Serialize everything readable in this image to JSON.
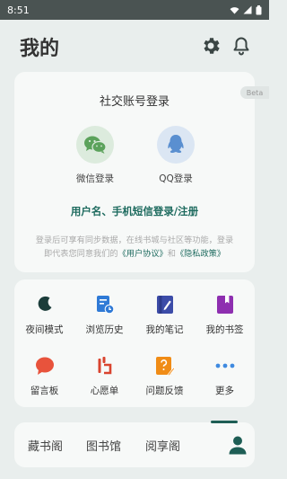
{
  "status": {
    "time": "8:51"
  },
  "header": {
    "title": "我的"
  },
  "login": {
    "title": "社交账号登录",
    "beta": "Beta",
    "wechat_label": "微信登录",
    "qq_label": "QQ登录",
    "phone_login": "用户名、手机短信登录/注册",
    "disclaimer_line1": "登录后可享有同步数据，在线书城与社区等功能，登录",
    "disclaimer_pre": "即代表您同意我们的",
    "user_agreement": "《用户协议》",
    "and": "和",
    "privacy_policy": "《隐私政策》"
  },
  "menu": [
    {
      "label": "夜间模式",
      "icon": "moon-icon"
    },
    {
      "label": "浏览历史",
      "icon": "history-icon"
    },
    {
      "label": "我的笔记",
      "icon": "notes-icon"
    },
    {
      "label": "我的书签",
      "icon": "bookmark-icon"
    },
    {
      "label": "留言板",
      "icon": "message-icon"
    },
    {
      "label": "心愿单",
      "icon": "wishlist-icon"
    },
    {
      "label": "问题反馈",
      "icon": "feedback-icon"
    },
    {
      "label": "更多",
      "icon": "more-icon"
    }
  ],
  "tabs": [
    {
      "label": "藏书阁"
    },
    {
      "label": "图书馆"
    },
    {
      "label": "阅享阁"
    },
    {
      "label": "我的",
      "icon": "person-icon",
      "active": true
    }
  ],
  "colors": {
    "accent": "#1e6b5f",
    "background": "#e9eeed",
    "card": "#f7f9f8"
  }
}
